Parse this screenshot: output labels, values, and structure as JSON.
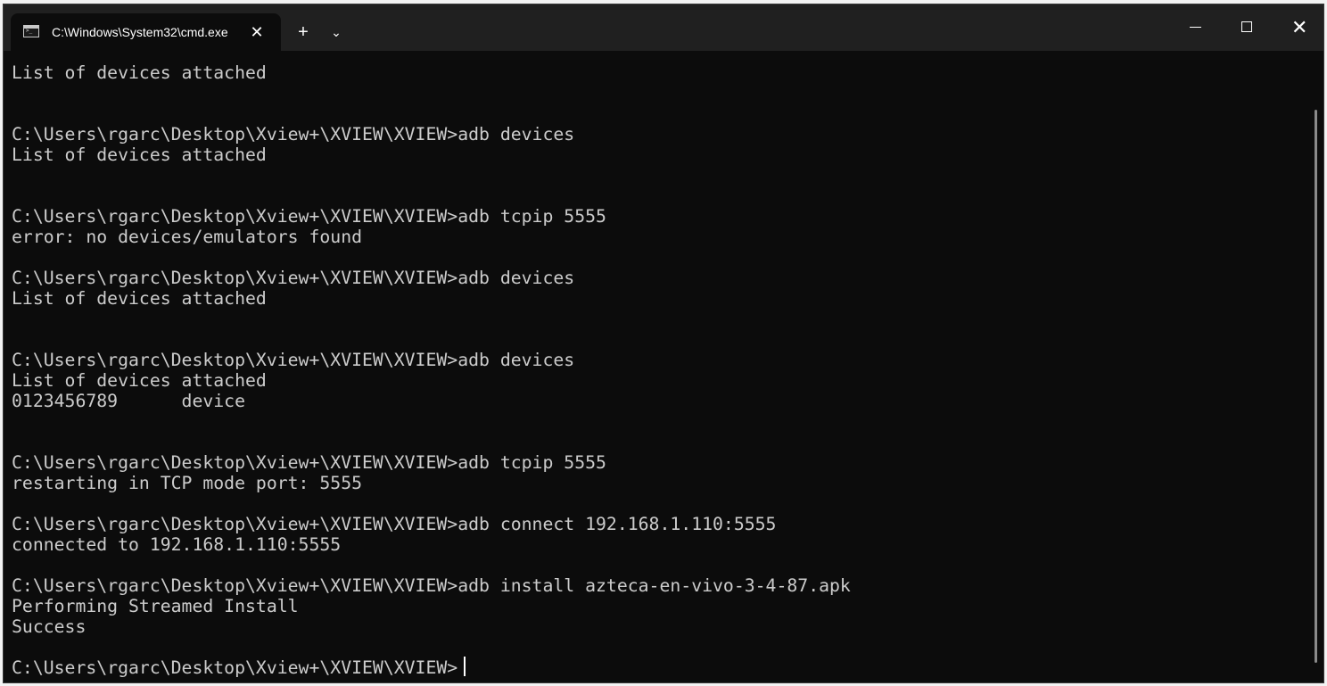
{
  "window": {
    "tab_title": "C:\\Windows\\System32\\cmd.exe",
    "tab_close_glyph": "✕",
    "new_tab_glyph": "+",
    "dropdown_glyph": "⌄",
    "close_glyph": "✕"
  },
  "icons": {
    "tab": "terminal-icon",
    "new_tab": "plus-icon",
    "dropdown": "chevron-down-icon",
    "minimize": "minimize-icon",
    "maximize": "maximize-icon",
    "close": "close-icon"
  },
  "colors": {
    "background": "#0c0c0c",
    "foreground": "#cccccc",
    "titlebar": "#202020"
  },
  "terminal": {
    "lines": [
      "List of devices attached",
      "",
      "",
      "C:\\Users\\rgarc\\Desktop\\Xview+\\XVIEW\\XVIEW>adb devices",
      "List of devices attached",
      "",
      "",
      "C:\\Users\\rgarc\\Desktop\\Xview+\\XVIEW\\XVIEW>adb tcpip 5555",
      "error: no devices/emulators found",
      "",
      "C:\\Users\\rgarc\\Desktop\\Xview+\\XVIEW\\XVIEW>adb devices",
      "List of devices attached",
      "",
      "",
      "C:\\Users\\rgarc\\Desktop\\Xview+\\XVIEW\\XVIEW>adb devices",
      "List of devices attached",
      "0123456789      device",
      "",
      "",
      "C:\\Users\\rgarc\\Desktop\\Xview+\\XVIEW\\XVIEW>adb tcpip 5555",
      "restarting in TCP mode port: 5555",
      "",
      "C:\\Users\\rgarc\\Desktop\\Xview+\\XVIEW\\XVIEW>adb connect 192.168.1.110:5555",
      "connected to 192.168.1.110:5555",
      "",
      "C:\\Users\\rgarc\\Desktop\\Xview+\\XVIEW\\XVIEW>adb install azteca-en-vivo-3-4-87.apk",
      "Performing Streamed Install",
      "Success",
      "",
      "C:\\Users\\rgarc\\Desktop\\Xview+\\XVIEW\\XVIEW>"
    ]
  }
}
